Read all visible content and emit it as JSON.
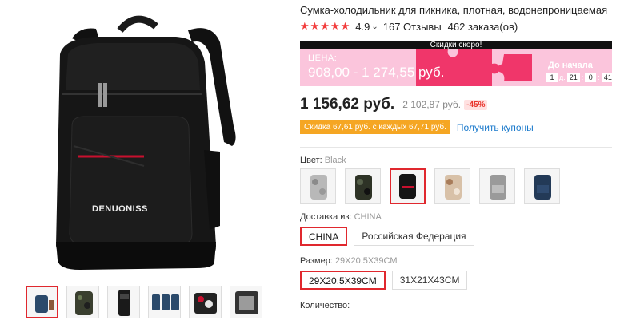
{
  "product": {
    "title": "Сумка-холодильник для пикника, плотная, водонепроницаемая",
    "brand_print": "DENUONISS",
    "stars": "★★★★★",
    "rating": "4.9",
    "reviews": "167 Отзывы",
    "orders": "462 заказа(ов)"
  },
  "promo": {
    "header": "Скидки скоро!",
    "label": "ЦЕНА:",
    "price_range": "908,00 - 1 274,55 руб.",
    "until_label": "До начала",
    "timer": {
      "days": "1",
      "days_unit": "д.",
      "hours": "21",
      "minutes": "0",
      "seconds": "41"
    },
    "colors": {
      "background": "#fbc5dc",
      "accent": "#f23c61"
    }
  },
  "pricing": {
    "price": "1 156,62 руб.",
    "old_price": "2 102,87 руб.",
    "discount": "-45%"
  },
  "coupon": {
    "badge": "Скидка 67,61 руб. с каждых 67,71 руб.",
    "link": "Получить купоны"
  },
  "options": {
    "color_label": "Цвет:",
    "color_value": "Black",
    "colors": [
      {
        "name": "gray-camo-bag"
      },
      {
        "name": "dark-camo-bag"
      },
      {
        "name": "black-bag",
        "selected": true
      },
      {
        "name": "desert-camo-bag"
      },
      {
        "name": "gray-bag"
      },
      {
        "name": "navy-bag"
      }
    ],
    "ship_label": "Доставка из:",
    "ship_value": "CHINA",
    "ship_options": [
      "CHINA",
      "Российская Федерация"
    ],
    "size_label": "Размер:",
    "size_value": "29X20.5X39CM",
    "size_options": [
      "29X20.5X39CM",
      "31X21X43CM"
    ],
    "qty_label": "Количество:"
  },
  "gallery": {
    "thumbnails": 7
  },
  "colors": {
    "accent": "#e0282e",
    "star": "#f23c3c",
    "coupon": "#f5a623",
    "link": "#1b7acc"
  }
}
